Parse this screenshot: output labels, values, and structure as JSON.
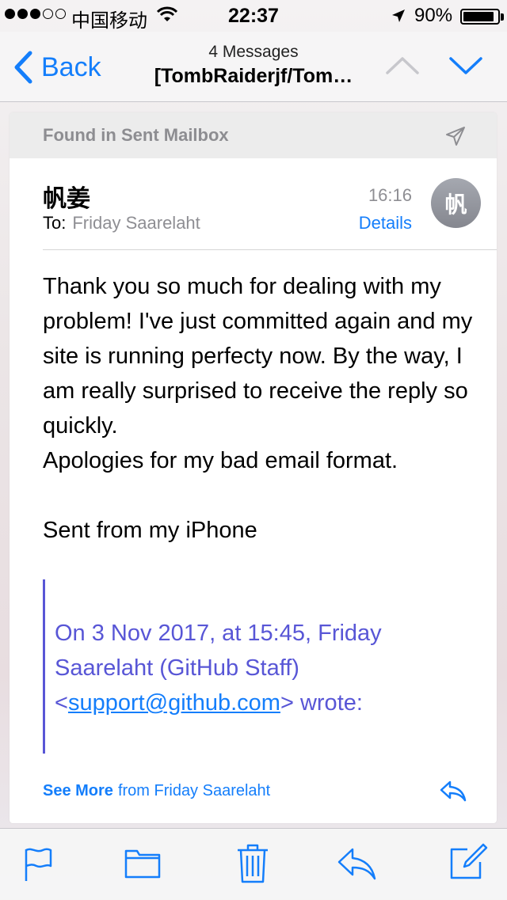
{
  "status_bar": {
    "carrier": "中国移动",
    "time": "22:37",
    "battery": "90%",
    "battery_level": 0.9
  },
  "nav": {
    "back_label": "Back",
    "message_count": "4 Messages",
    "subject": "[TombRaiderjf/Tom…"
  },
  "mailbox_banner": "Found in Sent Mailbox",
  "message": {
    "sender": "帆姜",
    "to_label": "To:",
    "to_name": "Friday Saarelaht",
    "time": "16:16",
    "details_label": "Details",
    "avatar_initial": "帆",
    "body_line_1": "Thank you so much for dealing with my problem!  I've just committed again and my site is running perfecty now. By the way, I am really surprised to receive the reply so quickly.",
    "body_line_2": "Apologies for my bad email format.",
    "signature": "Sent from my iPhone",
    "quote_pre": "On 3 Nov 2017, at 15:45, Friday Saarelaht (GitHub Staff) <",
    "quote_email": "support@github.com",
    "quote_post": "> wrote:"
  },
  "footer": {
    "see_more": "See More",
    "from_text": "from Friday Saarelaht"
  },
  "icons": {
    "nav": [
      "chevron-left-icon",
      "chevron-up-icon",
      "chevron-down-icon"
    ],
    "banner": "paper-plane-icon",
    "footer": "reply-icon",
    "toolbar": [
      "flag-icon",
      "folder-icon",
      "trash-icon",
      "reply-icon",
      "compose-icon"
    ]
  },
  "colors": {
    "accent": "#147efb",
    "quote": "#5856d6",
    "muted": "#8e8e93"
  }
}
